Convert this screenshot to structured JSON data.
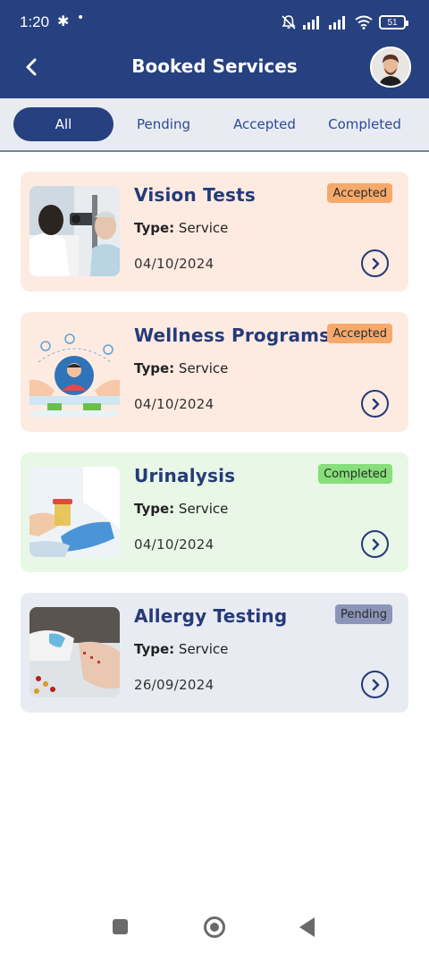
{
  "status_bar": {
    "time": "1:20",
    "battery": "51",
    "icons": [
      "slack-icon",
      "dot-icon",
      "bell-off-icon",
      "signal-icon",
      "signal-icon",
      "wifi-icon",
      "battery-icon"
    ]
  },
  "header": {
    "title": "Booked Services",
    "back_icon": "back-arrow-icon",
    "avatar": "user-avatar"
  },
  "tabs": [
    {
      "label": "All",
      "active": true
    },
    {
      "label": "Pending",
      "active": false
    },
    {
      "label": "Accepted",
      "active": false
    },
    {
      "label": "Completed",
      "active": false
    }
  ],
  "bookings": [
    {
      "title": "Vision Tests",
      "type_label": "Type:",
      "type": "Service",
      "date": "04/10/2024",
      "status": "Accepted",
      "card_color": "#fdebe1",
      "badge_color": "#f6a96b",
      "image": "eye-exam-photo"
    },
    {
      "title": "Wellness Programs",
      "type_label": "Type:",
      "type": "Service",
      "date": "04/10/2024",
      "status": "Accepted",
      "card_color": "#fdebe1",
      "badge_color": "#f6a96b",
      "image": "wellness-illustration"
    },
    {
      "title": "Urinalysis",
      "type_label": "Type:",
      "type": "Service",
      "date": "04/10/2024",
      "status": "Completed",
      "card_color": "#e8f7e6",
      "badge_color": "#86df7a",
      "image": "urine-sample-photo"
    },
    {
      "title": "Allergy Testing",
      "type_label": "Type:",
      "type": "Service",
      "date": "26/09/2024",
      "status": "Pending",
      "card_color": "#e9ebf2",
      "badge_color": "#8b95b8",
      "image": "allergy-test-photo"
    }
  ],
  "colors": {
    "primary": "#27407f",
    "title_text": "#253a78",
    "tab_bar": "#e9ebf2"
  },
  "nav_bar": [
    "recents-square-icon",
    "home-circle-icon",
    "back-triangle-icon"
  ]
}
